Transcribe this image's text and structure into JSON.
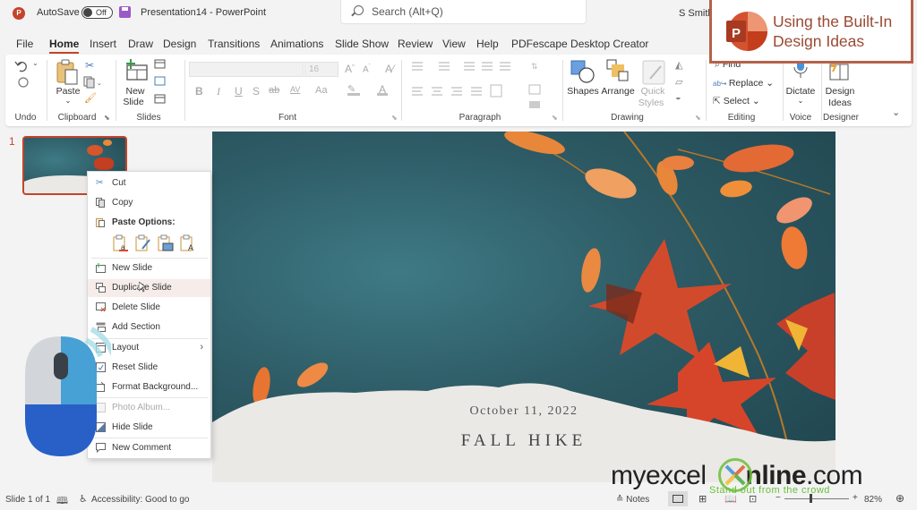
{
  "titlebar": {
    "autosave_label": "AutoSave",
    "autosave_state": "Off",
    "document_title": "Presentation14  -  PowerPoint",
    "search_placeholder": "Search (Alt+Q)",
    "user_name": "S Smith"
  },
  "menu": {
    "tabs": [
      {
        "label": "File"
      },
      {
        "label": "Home"
      },
      {
        "label": "Insert"
      },
      {
        "label": "Draw"
      },
      {
        "label": "Design"
      },
      {
        "label": "Transitions"
      },
      {
        "label": "Animations"
      },
      {
        "label": "Slide Show"
      },
      {
        "label": "Review"
      },
      {
        "label": "View"
      },
      {
        "label": "Help"
      },
      {
        "label": "PDFescape Desktop Creator"
      }
    ],
    "active": "Home"
  },
  "ribbon": {
    "groups": {
      "undo": "Undo",
      "clipboard": "Clipboard",
      "slides": "Slides",
      "font": "Font",
      "paragraph": "Paragraph",
      "drawing": "Drawing",
      "editing": "Editing",
      "voice": "Voice",
      "designer": "Designer"
    },
    "buttons": {
      "paste": "Paste",
      "new_slide_1": "New",
      "new_slide_2": "Slide",
      "font_size": "16",
      "shapes": "Shapes",
      "arrange": "Arrange",
      "quick_styles_1": "Quick",
      "quick_styles_2": "Styles",
      "find": "Find",
      "replace": "Replace",
      "select": "Select",
      "dictate": "Dictate",
      "design_ideas_1": "Design",
      "design_ideas_2": "Ideas"
    },
    "font_buttons": [
      "B",
      "I",
      "U",
      "S",
      "ab",
      "AV",
      "Aa"
    ]
  },
  "thumbnails": {
    "items": [
      {
        "number": "1",
        "selected": true
      }
    ]
  },
  "slide": {
    "date": "October 11, 2022",
    "title": "FALL HIKE"
  },
  "context_menu": {
    "items": [
      {
        "label": "Cut",
        "icon": "scissors-icon"
      },
      {
        "label": "Copy",
        "icon": "copy-icon"
      },
      {
        "label": "Paste Options:",
        "icon": "clipboard-icon",
        "bold": true
      },
      {
        "label": "New Slide",
        "icon": "new-slide-icon"
      },
      {
        "label": "Duplicate Slide",
        "icon": "duplicate-slide-icon",
        "highlighted": true
      },
      {
        "label": "Delete Slide",
        "icon": "delete-slide-icon"
      },
      {
        "label": "Add Section",
        "icon": "section-icon"
      },
      {
        "label": "Layout",
        "icon": "layout-icon",
        "submenu": true
      },
      {
        "label": "Reset Slide",
        "icon": "reset-slide-icon"
      },
      {
        "label": "Format Background...",
        "icon": "format-background-icon"
      },
      {
        "label": "Photo Album...",
        "icon": "photo-album-icon",
        "disabled": true
      },
      {
        "label": "Hide Slide",
        "icon": "hide-slide-icon"
      },
      {
        "label": "New Comment",
        "icon": "comment-icon"
      }
    ],
    "paste_options": [
      "use-destination-theme",
      "keep-source-formatting",
      "picture",
      "keep-text-only"
    ]
  },
  "statusbar": {
    "slide_info": "Slide 1 of 1",
    "accessibility": "Accessibility: Good to go",
    "notes": "Notes",
    "zoom_level": "82%",
    "zoom_minus": "−",
    "zoom_plus": "+"
  },
  "overlay": {
    "callout_line1": "Using the Built-In",
    "callout_line2": "Design Ideas",
    "watermark_brand_a": "myexcel",
    "watermark_brand_b": "nline",
    "watermark_brand_c": ".com",
    "watermark_tagline": "Stand out from the crowd"
  },
  "colors": {
    "accent": "#c4442a",
    "callout_border": "#b4624a",
    "slide_background": "#2f5d67",
    "mouse_blue": "#2860c8",
    "mouse_light_blue": "#47a1d4"
  }
}
